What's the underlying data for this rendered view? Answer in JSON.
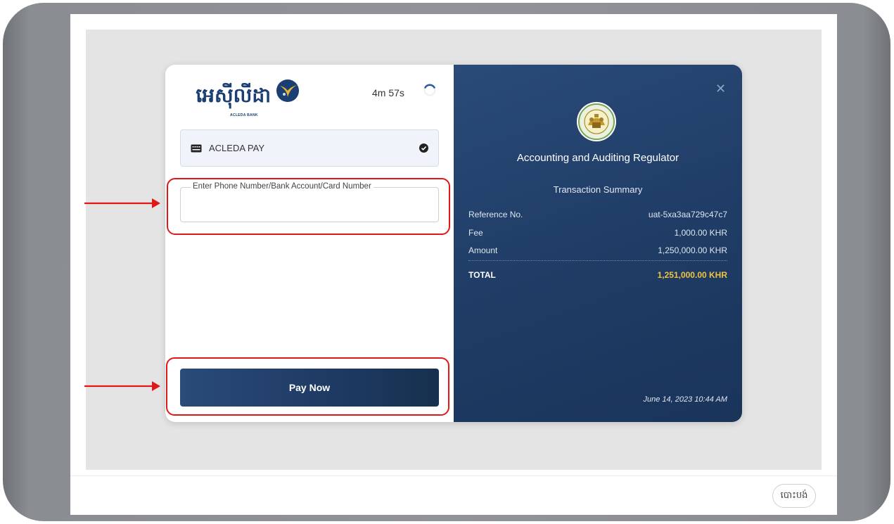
{
  "bank": {
    "logo_text": "អេស៊ីលីដា",
    "logo_sub": "ACLEDA BANK"
  },
  "timer": {
    "text": "4m 57s"
  },
  "payment_method": {
    "label": "ACLEDA PAY",
    "icon": "card-icon",
    "selected": true
  },
  "account_field": {
    "legend": "Enter Phone Number/Bank Account/Card Number",
    "value": ""
  },
  "pay_button": {
    "label": "Pay Now"
  },
  "merchant": {
    "name": "Accounting and Auditing Regulator",
    "emblem": "emblem-icon"
  },
  "summary": {
    "title": "Transaction Summary",
    "rows": [
      {
        "label": "Reference No.",
        "value": "uat-5xa3aa729c47c7"
      },
      {
        "label": "Fee",
        "value": "1,000.00 KHR"
      },
      {
        "label": "Amount",
        "value": "1,250,000.00 KHR"
      }
    ],
    "total": {
      "label": "TOTAL",
      "value": "1,251,000.00 KHR"
    },
    "date": "June 14, 2023 10:44 AM"
  },
  "footer": {
    "close_label": "បោះបង់"
  },
  "colors": {
    "brand_navy": "#1c3f73",
    "panel_blue": "#1f3d66",
    "total_gold": "#f3c340",
    "annotation_red": "#e01818"
  }
}
